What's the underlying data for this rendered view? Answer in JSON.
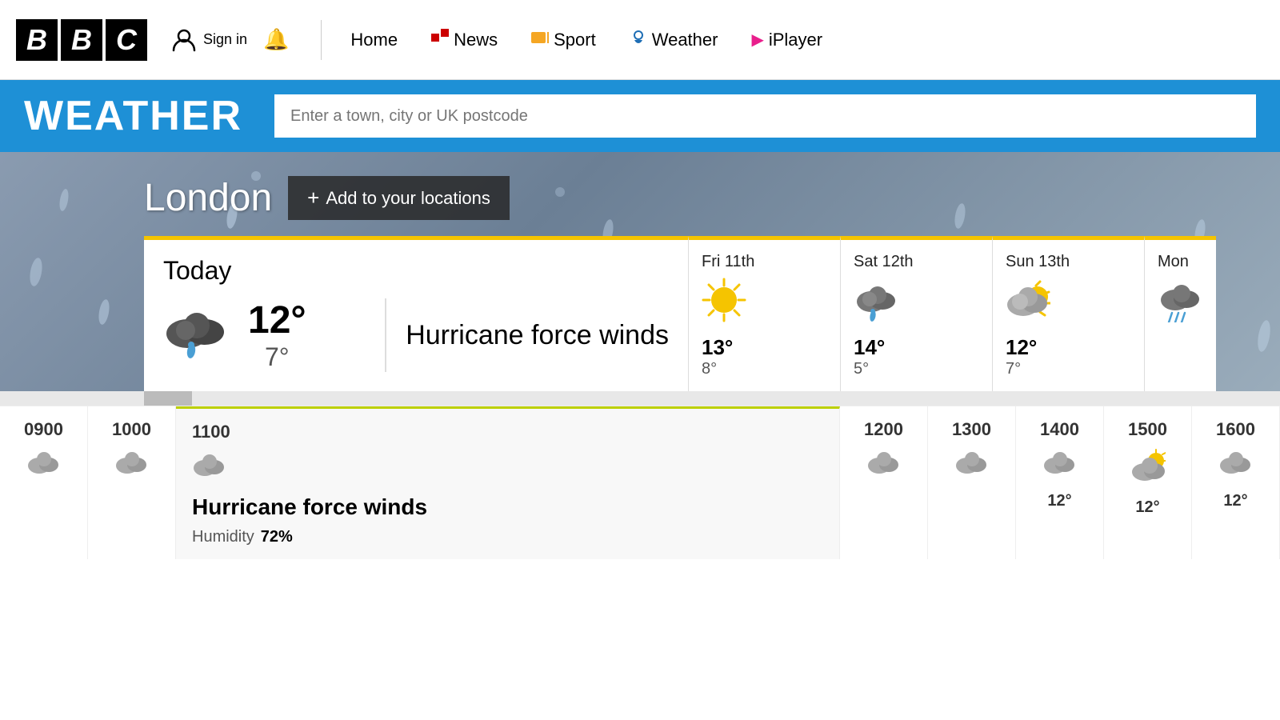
{
  "header": {
    "logo": {
      "letters": [
        "B",
        "B",
        "C"
      ]
    },
    "signin_label": "Sign in",
    "home_label": "Home",
    "nav": [
      {
        "id": "news",
        "label": "News",
        "icon": "news-icon"
      },
      {
        "id": "sport",
        "label": "Sport",
        "icon": "sport-icon"
      },
      {
        "id": "weather",
        "label": "Weather",
        "icon": "weather-icon"
      },
      {
        "id": "iplayer",
        "label": "iPlayer",
        "icon": "iplayer-icon"
      }
    ]
  },
  "weather_banner": {
    "title": "WEATHER",
    "search_placeholder": "Enter a town, city or UK postcode"
  },
  "hero": {
    "location": "London",
    "add_location_label": "Add  to your locations"
  },
  "today": {
    "label": "Today",
    "temp_high": "12°",
    "temp_low": "7°",
    "condition": "Hurricane force winds"
  },
  "forecast": [
    {
      "day": "Fri 11th",
      "temp_high": "13°",
      "temp_low": "8°",
      "icon": "sun"
    },
    {
      "day": "Sat 12th",
      "temp_high": "14°",
      "temp_low": "5°",
      "icon": "cloud-rain"
    },
    {
      "day": "Sun 13th",
      "temp_high": "12°",
      "temp_low": "7°",
      "icon": "cloud-sun"
    },
    {
      "day": "Mon",
      "temp_high": "",
      "temp_low": "",
      "icon": "cloud-rain-heavy"
    }
  ],
  "hourly": [
    {
      "time": "0900",
      "icon": "cloud",
      "temp": "",
      "active": false
    },
    {
      "time": "1000",
      "icon": "cloud",
      "temp": "",
      "active": false
    },
    {
      "time": "1100",
      "icon": "cloud",
      "temp": "",
      "active": true
    },
    {
      "time": "1200",
      "icon": "cloud",
      "temp": "",
      "active": false
    },
    {
      "time": "1300",
      "icon": "cloud",
      "temp": "",
      "active": false
    },
    {
      "time": "1400",
      "icon": "cloud",
      "temp": "12°",
      "active": false
    },
    {
      "time": "1500",
      "icon": "cloud-sun",
      "temp": "12°",
      "active": false
    },
    {
      "time": "1600",
      "icon": "cloud",
      "temp": "12°",
      "active": false
    }
  ],
  "current_detail": {
    "condition": "Hurricane force winds",
    "humidity_label": "Humidity",
    "humidity_value": "72%"
  }
}
